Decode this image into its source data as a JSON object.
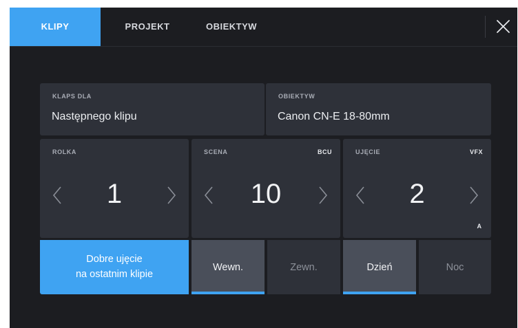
{
  "tabs": {
    "klipy": "KLIPY",
    "projekt": "PROJEKT",
    "obiektyw": "OBIEKTYW"
  },
  "fields": {
    "klaps_dla": {
      "label": "KLAPS DLA",
      "value": "Następnego klipu"
    },
    "obiektyw": {
      "label": "OBIEKTYW",
      "value": "Canon CN-E 18-80mm"
    }
  },
  "counters": {
    "rolka": {
      "label": "ROLKA",
      "value": "1"
    },
    "scena": {
      "label": "SCENA",
      "value": "10",
      "tag": "BCU"
    },
    "ujecie": {
      "label": "UJĘCIE",
      "value": "2",
      "tag": "VFX",
      "sub": "A"
    }
  },
  "good_take": {
    "line1": "Dobre ujęcie",
    "line2": "na ostatnim klipie"
  },
  "int_ext": {
    "int": "Wewn.",
    "ext": "Zewn.",
    "selected": "int"
  },
  "day_night": {
    "day": "Dzień",
    "night": "Noc",
    "selected": "day"
  },
  "colors": {
    "accent": "#3fa3f2",
    "background": "#1c1d21",
    "tile": "#2e3139",
    "tile_active": "#4a4f5a"
  }
}
